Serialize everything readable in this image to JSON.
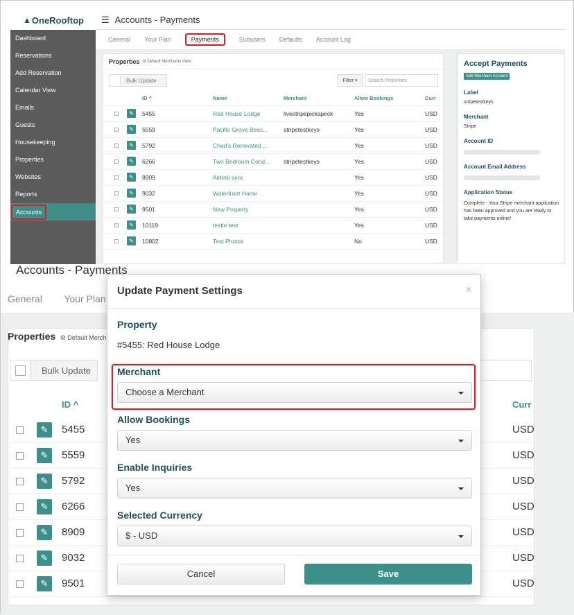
{
  "app": {
    "logo": "OneRooftop"
  },
  "header": {
    "title": "Accounts - Payments"
  },
  "sidebar": {
    "items": [
      {
        "label": "Dashboard"
      },
      {
        "label": "Reservations"
      },
      {
        "label": "Add Reservation"
      },
      {
        "label": "Calendar View"
      },
      {
        "label": "Emails"
      },
      {
        "label": "Guests"
      },
      {
        "label": "Housekeeping"
      },
      {
        "label": "Properties"
      },
      {
        "label": "Websites"
      },
      {
        "label": "Reports"
      },
      {
        "label": "Accounts"
      }
    ]
  },
  "tabs": [
    "General",
    "Your Plan",
    "Payments",
    "Subusers",
    "Defaults",
    "Account Log"
  ],
  "properties": {
    "title": "Properties",
    "view": "Default Merchants View",
    "bulk_update": "Bulk Update",
    "filter": "Filter",
    "search_placeholder": "Search Properties",
    "columns": {
      "id": "ID",
      "name": "Name",
      "merchant": "Merchant",
      "allow": "Allow Bookings",
      "currency": "Curr"
    },
    "rows": [
      {
        "id": "5455",
        "name": "Red House Lodge",
        "merchant": "livestripepickapeck",
        "allow": "Yes",
        "currency": "USD"
      },
      {
        "id": "5559",
        "name": "Pacific Grove Beac...",
        "merchant": "stripetestkeys",
        "allow": "Yes",
        "currency": "USD"
      },
      {
        "id": "5792",
        "name": "Chad's Renovated ...",
        "merchant": "",
        "allow": "Yes",
        "currency": "USD"
      },
      {
        "id": "6266",
        "name": "Two Bedroom Cond...",
        "merchant": "stripetestkeys",
        "allow": "Yes",
        "currency": "USD"
      },
      {
        "id": "8909",
        "name": "Airbnb sync",
        "merchant": "",
        "allow": "Yes",
        "currency": "USD"
      },
      {
        "id": "9032",
        "name": "Waterfront Home",
        "merchant": "",
        "allow": "Yes",
        "currency": "USD"
      },
      {
        "id": "9501",
        "name": "New Property",
        "merchant": "",
        "allow": "Yes",
        "currency": "USD"
      },
      {
        "id": "10119",
        "name": "testie test",
        "merchant": "",
        "allow": "Yes",
        "currency": "USD"
      },
      {
        "id": "10802",
        "name": "Test Photos",
        "merchant": "",
        "allow": "No",
        "currency": "USD"
      }
    ]
  },
  "accept": {
    "title": "Accept Payments",
    "add_button": "Add Merchant Account",
    "label_label": "Label",
    "label_value": "stripetestkeys",
    "merchant_label": "Merchant",
    "merchant_value": "Stripe",
    "account_id_label": "Account ID",
    "email_label": "Account Email Address",
    "status_label": "Application Status",
    "status_text": "Complete - Your Stripe merchant application has been approved and you are ready to take payments online!"
  },
  "modal": {
    "title": "Update Payment Settings",
    "close": "×",
    "property_label": "Property",
    "property_value": "#5455: Red House Lodge",
    "merchant_label": "Merchant",
    "merchant_value": "Choose a Merchant",
    "allow_label": "Allow Bookings",
    "allow_value": "Yes",
    "inquiries_label": "Enable Inquiries",
    "inquiries_value": "Yes",
    "currency_label": "Selected Currency",
    "currency_value": "$ - USD",
    "cancel": "Cancel",
    "save": "Save"
  },
  "zoom": {
    "title": "Accounts - Payments",
    "tabs": [
      "General",
      "Your Plan"
    ],
    "properties_title": "Properties",
    "view": "Default Merch",
    "bulk_update": "Bulk Update",
    "id_header": "ID",
    "cur_header": "Curr",
    "ids": [
      "5455",
      "5559",
      "5792",
      "6266",
      "8909",
      "9032",
      "9501"
    ],
    "cur": "USD"
  },
  "colors": {
    "accent": "#3d8f89",
    "highlight": "#d0202a",
    "sidebar": "#5b5b5b"
  }
}
